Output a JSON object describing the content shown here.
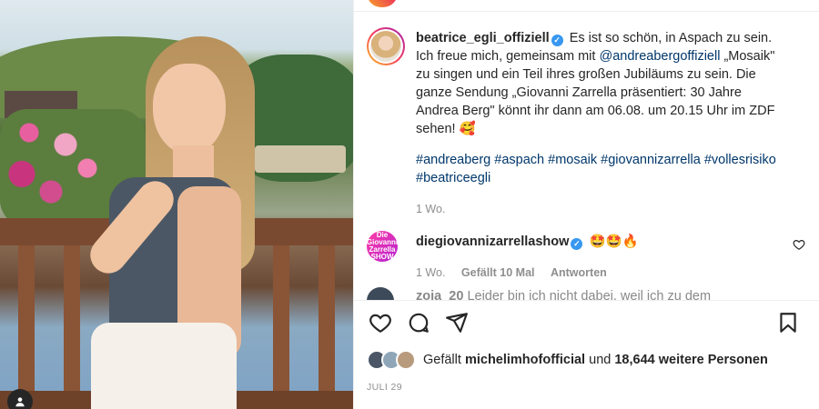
{
  "post": {
    "author": "beatrice_egli_offiziell",
    "caption_part1": "Es ist so schön, in Aspach zu sein. Ich freue mich, gemeinsam mit",
    "mention": "@andreabergoffiziell",
    "caption_part2": "„Mosaik\" zu singen und ein Teil ihres großen Jubiläums zu sein. Die ganze Sendung „Giovanni Zarrella präsentiert: 30 Jahre Andrea Berg\" könnt ihr dann am 06.08. um 20.15 Uhr im ZDF sehen! 🥰",
    "hashtags": [
      "#andreaberg",
      "#aspach",
      "#mosaik",
      "#giovannizarrella",
      "#vollesrisiko",
      "#beatriceegli"
    ],
    "age": "1 Wo."
  },
  "comments": [
    {
      "author": "diegiovannizarrellashow",
      "avatar_text": "Die Giovanni Zarrella SHOW",
      "text": "🤩🤩🔥",
      "age": "1 Wo.",
      "likes": "Gefällt 10 Mal",
      "reply": "Antworten"
    },
    {
      "author": "zoja_20",
      "text": "Leider bin ich nicht dabei, weil ich zu dem"
    }
  ],
  "likes": {
    "prefix": "Gefällt",
    "user": "michelimhofofficial",
    "middle": "und",
    "others": "18,644 weitere Personen"
  },
  "date": "JULI 29",
  "icons": {
    "verified": "verified-badge-icon",
    "like": "heart-icon",
    "comment": "comment-bubble-icon",
    "share": "send-icon",
    "save": "bookmark-icon",
    "user_tag": "user-tag-icon"
  },
  "colors": {
    "link": "#00376b",
    "verified": "#3897f0",
    "meta": "#8e8e8e"
  }
}
